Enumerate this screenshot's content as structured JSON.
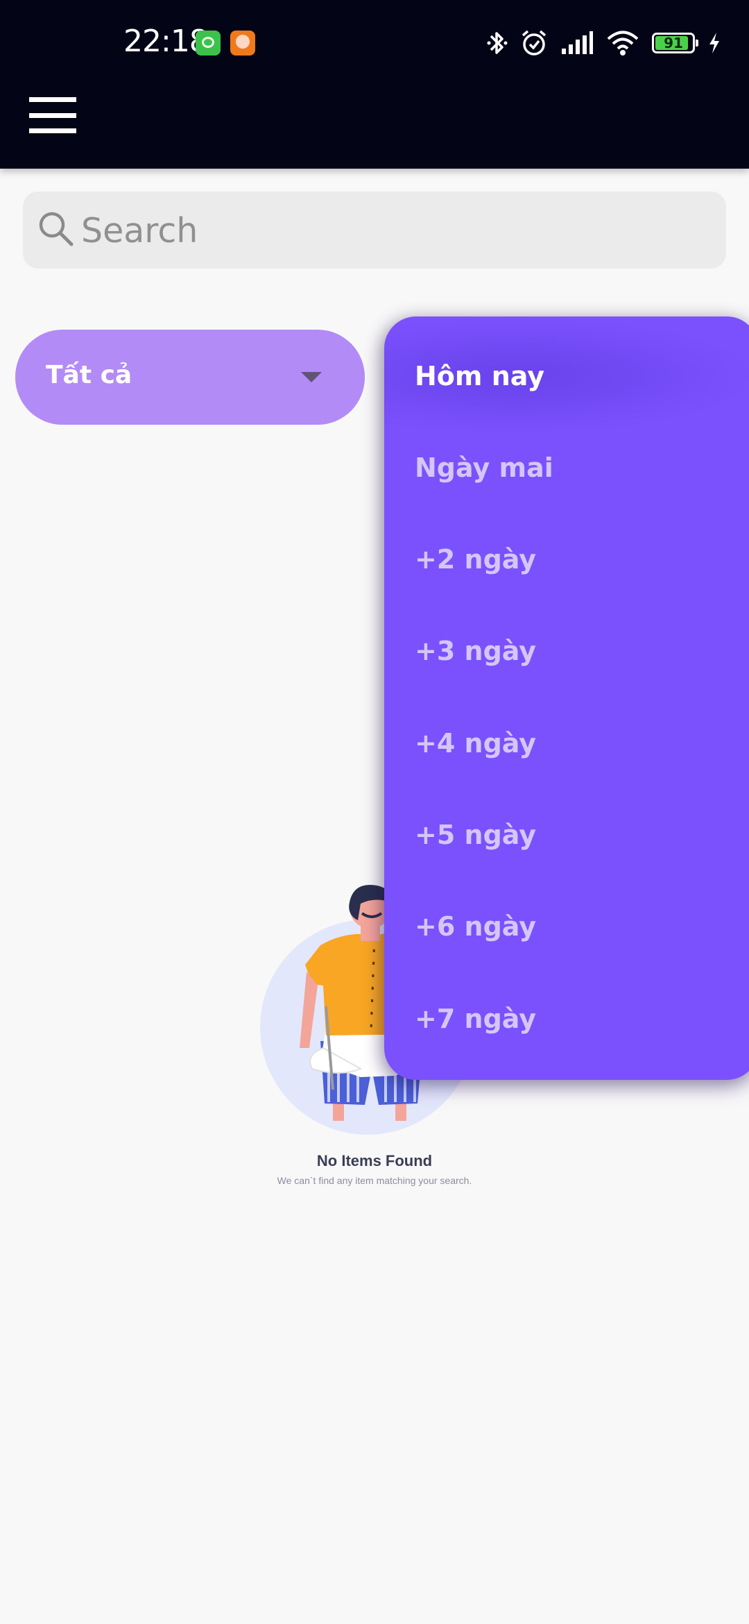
{
  "status_bar": {
    "time": "22:18",
    "battery_level": "91",
    "battery_fraction": 0.91,
    "icons": [
      "green-cat-app-icon",
      "orange-app-icon",
      "bluetooth-icon",
      "alarm-icon",
      "signal-icon",
      "wifi-icon",
      "battery-icon",
      "charging-icon"
    ]
  },
  "app_bar": {
    "menu_icon": "hamburger-menu-icon"
  },
  "search": {
    "placeholder": "Search",
    "value": ""
  },
  "filter": {
    "selected": "Tất cả"
  },
  "dropdown": {
    "items": [
      {
        "label": "Hôm nay",
        "selected": true
      },
      {
        "label": "Ngày mai",
        "selected": false
      },
      {
        "label": "+2 ngày",
        "selected": false
      },
      {
        "label": "+3 ngày",
        "selected": false
      },
      {
        "label": "+4 ngày",
        "selected": false
      },
      {
        "label": "+5 ngày",
        "selected": false
      },
      {
        "label": "+6 ngày",
        "selected": false
      },
      {
        "label": "+7 ngày",
        "selected": false
      }
    ]
  },
  "empty_state": {
    "title": "No Items Found",
    "subtitle": "We can`t find any item matching your search."
  },
  "colors": {
    "app_bar": "#030416",
    "background": "#f8f8f8",
    "filter": "#b28bf7",
    "dropdown": "#7b51fd",
    "search_bg": "#ebebeb"
  }
}
